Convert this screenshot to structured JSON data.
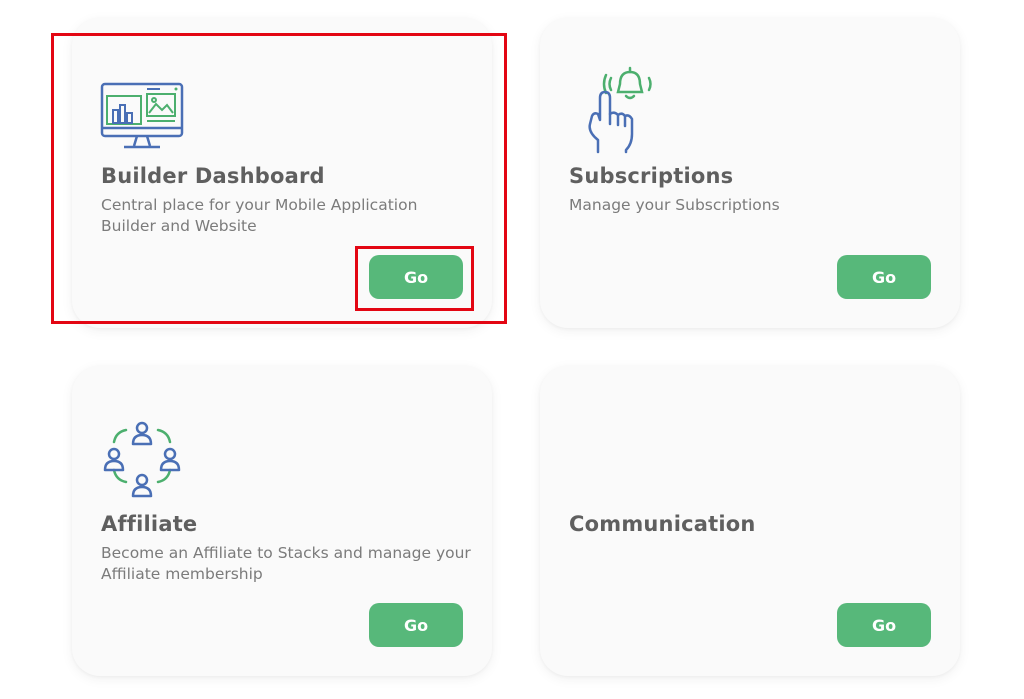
{
  "cards": {
    "builder": {
      "title": "Builder Dashboard",
      "description": "Central place for your Mobile Application Builder and Website",
      "button_label": "Go",
      "icon": "monitor-dashboard-icon"
    },
    "subscriptions": {
      "title": "Subscriptions",
      "description": "Manage your Subscriptions",
      "button_label": "Go",
      "icon": "hand-bell-notification-icon"
    },
    "affiliate": {
      "title": "Affiliate",
      "description": "Become an Affiliate to Stacks and manage your Affiliate membership",
      "button_label": "Go",
      "icon": "people-network-icon"
    },
    "communication": {
      "title": "Communication",
      "description": "",
      "button_label": "Go"
    }
  },
  "colors": {
    "button": "#57b87a",
    "highlight": "#e30613",
    "icon_blue": "#4a6fb5",
    "icon_green": "#4caf6e"
  }
}
